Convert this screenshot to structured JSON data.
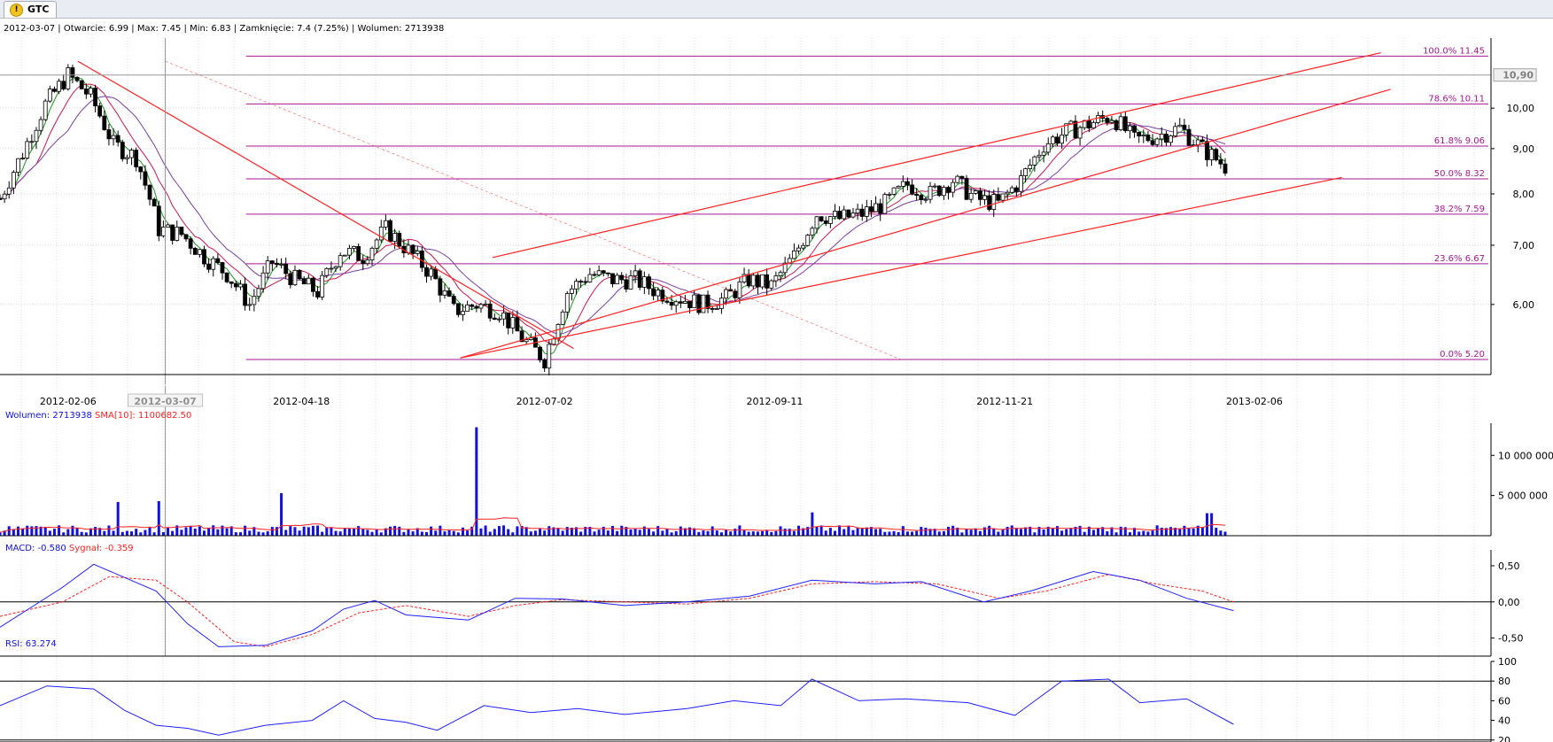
{
  "tab": {
    "title": "GTC",
    "icon": "warning-icon"
  },
  "colors": {
    "up": "#ffffff",
    "down": "#000000",
    "fib": "#a6178f",
    "fibText": "#a6178f",
    "trend": "#ff2020",
    "sma5": "#1a9a1a",
    "sma10": "#c8174c",
    "sma20": "#7a3ea3",
    "volume": "#1010e0",
    "volumeSma": "#ff2020",
    "macd": "#2020ff",
    "signal": "#ff2020",
    "rsi": "#2020ff"
  },
  "chart_data": {
    "type": "candlestick",
    "instrument": "GTC",
    "info": {
      "date": "2012-03-07",
      "open": "Otwarcie: 6.99",
      "max": "Max: 7.45",
      "min": "Min: 6.83",
      "close": "Zamknięcie: 7.4 (7.25%)",
      "volume": "Wolumen: 2713938"
    },
    "price_axis": {
      "scale": "log",
      "ylim": [
        5.0,
        12.0
      ],
      "ticks": [
        "10,00",
        "9,00",
        "8,00",
        "7,00",
        "6,00"
      ],
      "tick_values": [
        10,
        9,
        8,
        7,
        6
      ]
    },
    "current_price_label": "10,90",
    "current_price_value": 10.9,
    "x_range": [
      "2012-01-16",
      "2013-04-20"
    ],
    "date_ticks": [
      "2012-02-06",
      "2012-04-18",
      "2012-07-02",
      "2012-09-11",
      "2012-11-21",
      "2013-02-06"
    ],
    "cursor_date_label": "2012-03-07",
    "cursor_date": "2012-03-07",
    "fibonacci": {
      "from_date": "2012-04-02",
      "to_date": "2013-02-12",
      "levels": [
        {
          "label": "100.0% 11.45",
          "value": 11.45
        },
        {
          "label": "78.6% 10.11",
          "value": 10.11
        },
        {
          "label": "61.8% 9.06",
          "value": 9.06
        },
        {
          "label": "50.0% 8.32",
          "value": 8.32
        },
        {
          "label": "38.2% 7.59",
          "value": 7.59
        },
        {
          "label": "23.6% 6.67",
          "value": 6.67
        },
        {
          "label": "0.0% 5.20",
          "value": 5.2
        }
      ]
    },
    "trend_lines": [
      {
        "from": [
          "2012-02-09",
          11.3
        ],
        "to": [
          "2012-07-11",
          5.35
        ],
        "style": "solid"
      },
      {
        "from": [
          "2012-03-07",
          11.3
        ],
        "to": [
          "2012-10-20",
          5.2
        ],
        "style": "dashed"
      },
      {
        "from": [
          "2012-06-06",
          5.22
        ],
        "to": [
          "2013-03-05",
          8.35
        ],
        "style": "solid"
      },
      {
        "from": [
          "2012-06-06",
          5.22
        ],
        "to": [
          "2013-03-20",
          10.5
        ],
        "style": "solid"
      },
      {
        "from": [
          "2012-06-16",
          6.78
        ],
        "to": [
          "2013-03-17",
          11.55
        ],
        "style": "solid"
      }
    ],
    "price_series": [
      [
        "2012-01-16",
        7.9
      ],
      [
        "2012-01-23",
        8.9
      ],
      [
        "2012-01-30",
        10.1
      ],
      [
        "2012-02-06",
        10.9
      ],
      [
        "2012-02-13",
        10.3
      ],
      [
        "2012-02-20",
        9.1
      ],
      [
        "2012-02-27",
        8.8
      ],
      [
        "2012-03-05",
        7.3
      ],
      [
        "2012-03-12",
        7.2
      ],
      [
        "2012-03-19",
        6.8
      ],
      [
        "2012-03-26",
        6.5
      ],
      [
        "2012-04-02",
        6.0
      ],
      [
        "2012-04-09",
        6.7
      ],
      [
        "2012-04-16",
        6.4
      ],
      [
        "2012-04-23",
        6.2
      ],
      [
        "2012-04-30",
        6.9
      ],
      [
        "2012-05-07",
        6.8
      ],
      [
        "2012-05-14",
        7.3
      ],
      [
        "2012-05-21",
        6.9
      ],
      [
        "2012-05-28",
        6.5
      ],
      [
        "2012-06-04",
        5.9
      ],
      [
        "2012-06-11",
        6.0
      ],
      [
        "2012-06-18",
        5.9
      ],
      [
        "2012-06-25",
        5.5
      ],
      [
        "2012-07-02",
        5.2
      ],
      [
        "2012-07-09",
        6.2
      ],
      [
        "2012-07-16",
        6.5
      ],
      [
        "2012-07-23",
        6.4
      ],
      [
        "2012-07-30",
        6.4
      ],
      [
        "2012-08-06",
        6.2
      ],
      [
        "2012-08-13",
        6.1
      ],
      [
        "2012-08-20",
        6.0
      ],
      [
        "2012-08-27",
        6.1
      ],
      [
        "2012-09-03",
        6.4
      ],
      [
        "2012-09-10",
        6.3
      ],
      [
        "2012-09-17",
        6.8
      ],
      [
        "2012-09-24",
        7.6
      ],
      [
        "2012-10-01",
        7.5
      ],
      [
        "2012-10-08",
        7.6
      ],
      [
        "2012-10-15",
        7.8
      ],
      [
        "2012-10-22",
        8.2
      ],
      [
        "2012-10-29",
        8.0
      ],
      [
        "2012-11-05",
        8.3
      ],
      [
        "2012-11-12",
        7.9
      ],
      [
        "2012-11-19",
        7.8
      ],
      [
        "2012-11-26",
        8.3
      ],
      [
        "2012-12-03",
        9.1
      ],
      [
        "2012-12-10",
        9.4
      ],
      [
        "2012-12-17",
        9.6
      ],
      [
        "2012-12-24",
        9.8
      ],
      [
        "2012-12-31",
        9.2
      ],
      [
        "2013-01-07",
        9.3
      ],
      [
        "2013-01-14",
        9.5
      ],
      [
        "2013-01-21",
        9.0
      ],
      [
        "2013-01-28",
        8.6
      ]
    ],
    "volume_panel": {
      "header": "Wolumen: 2713938",
      "sma_header": "SMA[10]: 1100682.50",
      "ticks": [
        "10 000 000",
        "5 000 000"
      ],
      "tick_values": [
        10000000,
        5000000
      ],
      "ylim": [
        0,
        14000000
      ],
      "spikes": [
        {
          "date": "2012-06-11",
          "value": 13500000
        },
        {
          "date": "2012-04-12",
          "value": 5300000
        },
        {
          "date": "2012-03-05",
          "value": 4300000
        },
        {
          "date": "2012-02-22",
          "value": 4200000
        },
        {
          "date": "2013-01-31",
          "value": 3400000
        },
        {
          "date": "2013-01-23",
          "value": 2800000
        },
        {
          "date": "2012-09-22",
          "value": 2900000
        }
      ],
      "base": 1000000
    },
    "macd_panel": {
      "header_macd": "MACD: -0.580",
      "header_signal": "Sygnał: -0.359",
      "ticks": [
        "0,50",
        "0,00",
        "-0,50"
      ],
      "tick_values": [
        0.5,
        0,
        -0.5
      ],
      "ylim": [
        -0.75,
        0.72
      ],
      "macd": [
        [
          0,
          -0.35
        ],
        [
          4,
          0.2
        ],
        [
          6,
          0.52
        ],
        [
          10,
          0.15
        ],
        [
          12,
          -0.3
        ],
        [
          14,
          -0.62
        ],
        [
          17,
          -0.6
        ],
        [
          20,
          -0.4
        ],
        [
          22,
          -0.1
        ],
        [
          24,
          0.02
        ],
        [
          26,
          -0.18
        ],
        [
          30,
          -0.25
        ],
        [
          33,
          0.05
        ],
        [
          36,
          0.04
        ],
        [
          40,
          -0.05
        ],
        [
          44,
          0.0
        ],
        [
          48,
          0.08
        ],
        [
          52,
          0.3
        ],
        [
          56,
          0.25
        ],
        [
          59,
          0.28
        ],
        [
          63,
          0.0
        ],
        [
          66,
          0.15
        ],
        [
          70,
          0.42
        ],
        [
          73,
          0.3
        ],
        [
          76,
          0.05
        ],
        [
          79,
          -0.12
        ]
      ],
      "signal": [
        [
          0,
          -0.2
        ],
        [
          4,
          0.0
        ],
        [
          7,
          0.35
        ],
        [
          10,
          0.3
        ],
        [
          12,
          0.0
        ],
        [
          15,
          -0.55
        ],
        [
          17,
          -0.62
        ],
        [
          20,
          -0.45
        ],
        [
          23,
          -0.15
        ],
        [
          26,
          -0.05
        ],
        [
          30,
          -0.2
        ],
        [
          33,
          -0.05
        ],
        [
          36,
          0.03
        ],
        [
          40,
          0.0
        ],
        [
          44,
          -0.03
        ],
        [
          48,
          0.05
        ],
        [
          52,
          0.25
        ],
        [
          56,
          0.28
        ],
        [
          60,
          0.25
        ],
        [
          64,
          0.05
        ],
        [
          67,
          0.15
        ],
        [
          71,
          0.38
        ],
        [
          74,
          0.25
        ],
        [
          77,
          0.15
        ],
        [
          79,
          0.0
        ]
      ]
    },
    "rsi_panel": {
      "header": "RSI: 63.274",
      "ticks": [
        "100",
        "80",
        "60",
        "40",
        "20"
      ],
      "tick_values": [
        100,
        80,
        60,
        40,
        20
      ],
      "ylim": [
        18,
        100
      ],
      "values": [
        [
          0,
          55
        ],
        [
          3,
          75
        ],
        [
          6,
          72
        ],
        [
          8,
          50
        ],
        [
          10,
          35
        ],
        [
          12,
          32
        ],
        [
          14,
          25
        ],
        [
          17,
          35
        ],
        [
          20,
          40
        ],
        [
          22,
          60
        ],
        [
          24,
          42
        ],
        [
          26,
          38
        ],
        [
          28,
          30
        ],
        [
          31,
          55
        ],
        [
          34,
          48
        ],
        [
          37,
          52
        ],
        [
          40,
          46
        ],
        [
          44,
          52
        ],
        [
          47,
          60
        ],
        [
          50,
          55
        ],
        [
          52,
          82
        ],
        [
          55,
          60
        ],
        [
          58,
          62
        ],
        [
          62,
          58
        ],
        [
          65,
          45
        ],
        [
          68,
          80
        ],
        [
          71,
          82
        ],
        [
          73,
          58
        ],
        [
          76,
          62
        ],
        [
          79,
          36
        ]
      ]
    }
  }
}
